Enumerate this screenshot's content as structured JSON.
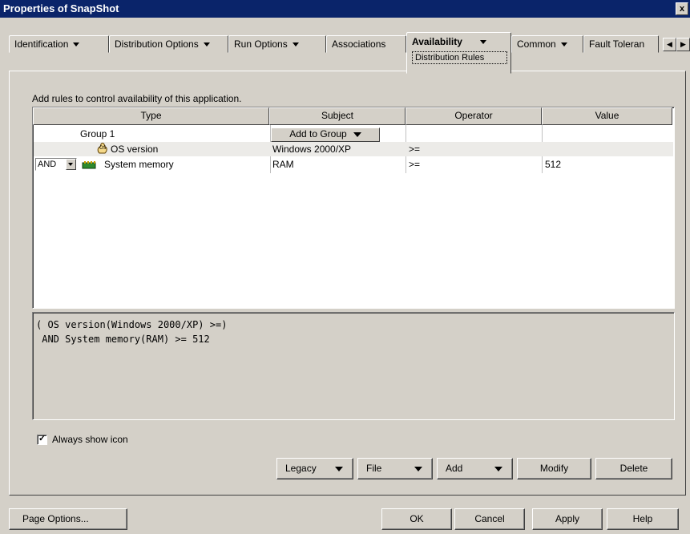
{
  "window": {
    "title": "Properties of SnapShot",
    "close_label": "x"
  },
  "tabs": [
    {
      "label": "Identification",
      "has_menu": true
    },
    {
      "label": "Distribution Options",
      "has_menu": true
    },
    {
      "label": "Run Options",
      "has_menu": true
    },
    {
      "label": "Associations",
      "has_menu": false
    },
    {
      "label": "Availability",
      "has_menu": true,
      "active": true,
      "subtab": "Distribution Rules"
    },
    {
      "label": "Common",
      "has_menu": true
    },
    {
      "label": "Fault Toleran",
      "has_menu": false
    }
  ],
  "tab_scroll": {
    "left": "◀",
    "right": "▶"
  },
  "panel": {
    "description": "Add rules to control availability of this application."
  },
  "grid": {
    "columns": [
      "Type",
      "Subject",
      "Operator",
      "Value"
    ],
    "group": {
      "label": "Group 1",
      "add_to_group": "Add to Group"
    },
    "rows": [
      {
        "connector": "",
        "icon": "os-icon",
        "type": "OS version",
        "subject": "Windows 2000/XP",
        "operator": ">=",
        "value": ""
      },
      {
        "connector": "AND",
        "icon": "memory-icon",
        "type": "System memory",
        "subject": "RAM",
        "operator": ">=",
        "value": "512"
      }
    ]
  },
  "preview": {
    "lines": [
      "( OS version(Windows 2000/XP) >=)",
      " AND System memory(RAM) >= 512"
    ]
  },
  "options": {
    "always_show_icon": {
      "label": "Always show icon",
      "checked": true
    }
  },
  "actions": {
    "legacy": "Legacy",
    "file": "File",
    "add": "Add",
    "modify": "Modify",
    "delete": "Delete"
  },
  "footer": {
    "page_options": "Page Options...",
    "ok": "OK",
    "cancel": "Cancel",
    "apply": "Apply",
    "help": "Help"
  },
  "colors": {
    "titlebar": "#0a246a",
    "face": "#d4d0c8",
    "row_highlight": "#ecebe8"
  }
}
